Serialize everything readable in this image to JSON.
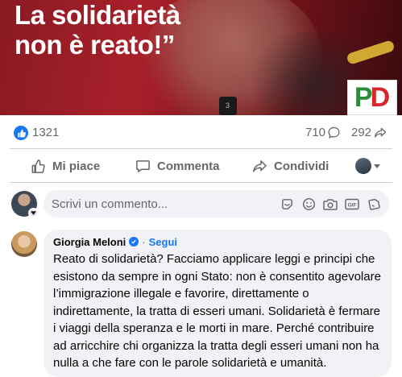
{
  "post_image": {
    "quote_line1": "La solidarietà",
    "quote_line2": "non è reato!”",
    "logo_p": "P",
    "logo_d": "D",
    "mic_label": "3"
  },
  "reactions": {
    "icon": "like-icon",
    "count": "1321",
    "comments_count": "710",
    "shares_count": "292"
  },
  "actions": {
    "like_label": "Mi piace",
    "comment_label": "Commenta",
    "share_label": "Condividi"
  },
  "composer": {
    "placeholder": "Scrivi un commento...",
    "icons": [
      "sticker-icon",
      "emoji-icon",
      "camera-icon",
      "gif-icon",
      "sticker-alt-icon"
    ]
  },
  "comment": {
    "author": "Giorgia Meloni",
    "follow_label": "Segui",
    "text": "Reato di solidarietà? Facciamo applicare leggi e principi che esistono da sempre in ogni Stato: non è consentito agevolare l’immigrazione illegale e favorire, direttamente o indirettamente, la tratta di esseri umani. Solidarietà è fermare i viaggi della speranza e le morti in mare. Perché contribuire ad arricchire chi organizza la tratta degli esseri umani non ha nulla a che fare con le parole solidarietà e umanità."
  },
  "colors": {
    "accent": "#1877f2",
    "muted": "#65676b",
    "bubble": "#f0f2f5",
    "hero_red": "#a8202b"
  }
}
